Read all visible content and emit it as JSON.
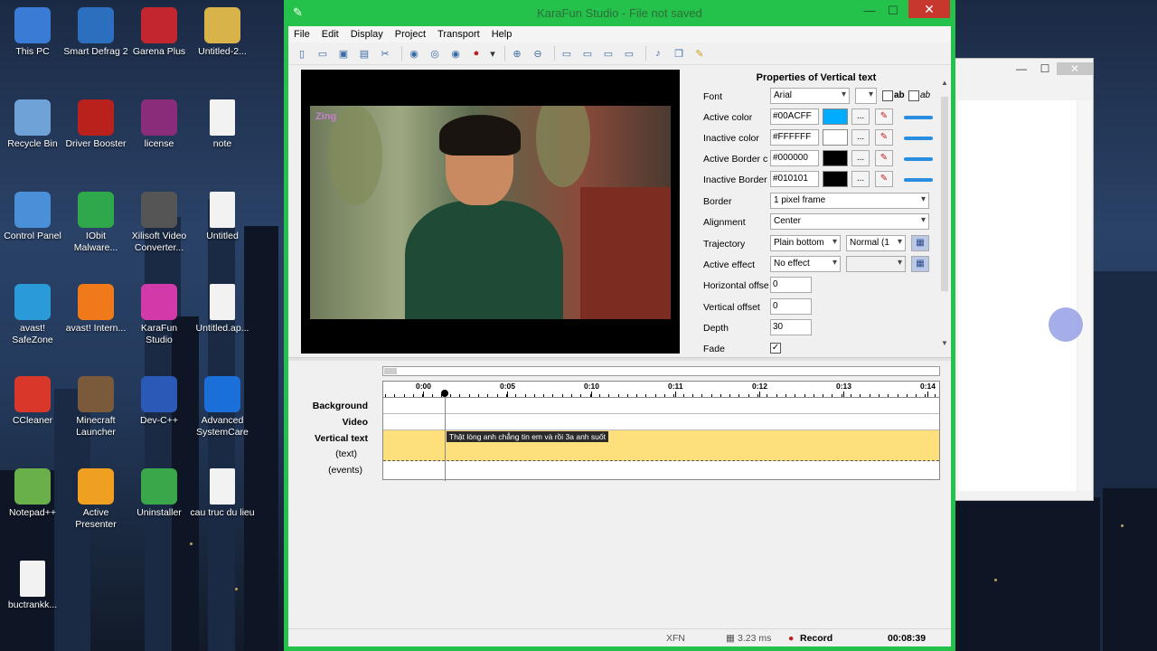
{
  "desktop": {
    "icons": [
      {
        "label": "This PC",
        "icon": "computer-icon",
        "color": "#3a7bd5"
      },
      {
        "label": "Smart Defrag 2",
        "icon": "defrag-icon",
        "color": "#2c6fbe"
      },
      {
        "label": "Garena Plus",
        "icon": "garena-icon",
        "color": "#c4262e"
      },
      {
        "label": "Untitled-2...",
        "icon": "folder-icon",
        "color": "#d8b34a"
      },
      {
        "label": "Recycle Bin",
        "icon": "recycle-bin-icon",
        "color": "#6fa3d8"
      },
      {
        "label": "Driver Booster",
        "icon": "driver-booster-icon",
        "color": "#b8211c"
      },
      {
        "label": "license",
        "icon": "winrar-icon",
        "color": "#8a2c7a"
      },
      {
        "label": "note",
        "icon": "document-icon",
        "color": "#f2f2f2"
      },
      {
        "label": "Control Panel",
        "icon": "control-panel-icon",
        "color": "#4a90d9"
      },
      {
        "label": "IObit Malware...",
        "icon": "iobit-icon",
        "color": "#2ea84a"
      },
      {
        "label": "Xilisoft Video Converter...",
        "icon": "film-reel-icon",
        "color": "#555555"
      },
      {
        "label": "Untitled",
        "icon": "vlc-document-icon",
        "color": "#f2f2f2"
      },
      {
        "label": "avast! SafeZone",
        "icon": "safezone-icon",
        "color": "#2a9ad8"
      },
      {
        "label": "avast! Intern...",
        "icon": "avast-icon",
        "color": "#f07a1a"
      },
      {
        "label": "KaraFun Studio",
        "icon": "karafun-icon",
        "color": "#d13aa8"
      },
      {
        "label": "Untitled.ap...",
        "icon": "document-icon",
        "color": "#f2f2f2"
      },
      {
        "label": "CCleaner",
        "icon": "ccleaner-icon",
        "color": "#d8372a"
      },
      {
        "label": "Minecraft Launcher",
        "icon": "minecraft-icon",
        "color": "#7a5a3a"
      },
      {
        "label": "Dev-C++",
        "icon": "devcpp-icon",
        "color": "#2a5ab8"
      },
      {
        "label": "Advanced SystemCare",
        "icon": "systemcare-icon",
        "color": "#1a6fd8"
      },
      {
        "label": "Notepad++",
        "icon": "notepadpp-icon",
        "color": "#6ab04a"
      },
      {
        "label": "Active Presenter",
        "icon": "active-presenter-icon",
        "color": "#f0a020"
      },
      {
        "label": "Uninstaller",
        "icon": "uninstaller-icon",
        "color": "#3aa84a"
      },
      {
        "label": "cau truc du lieu",
        "icon": "document-icon",
        "color": "#f2f2f2"
      },
      {
        "label": "buctrankk...",
        "icon": "document-icon",
        "color": "#f2f2f2"
      }
    ],
    "background_caret_text": "^^"
  },
  "window": {
    "title": "KaraFun Studio - File not saved",
    "minimize": "—",
    "maximize": "☐",
    "close": "✕",
    "accent": "#24c24a"
  },
  "menu": [
    "File",
    "Edit",
    "Display",
    "Project",
    "Transport",
    "Help"
  ],
  "video": {
    "logo": "Zing"
  },
  "properties": {
    "title": "Properties of Vertical text",
    "font_label": "Font",
    "font_value": "Arial",
    "font_size_value": "",
    "bold_label": "ab",
    "italic_label": "ab",
    "active_color_label": "Active color",
    "active_color_value": "#00ACFF",
    "inactive_color_label": "Inactive color",
    "inactive_color_value": "#FFFFFF",
    "active_border_label": "Active Border c",
    "active_border_value": "#000000",
    "inactive_border_label": "Inactive Border",
    "inactive_border_value": "#010101",
    "border_label": "Border",
    "border_value": "1 pixel frame",
    "alignment_label": "Alignment",
    "alignment_value": "Center",
    "trajectory_label": "Trajectory",
    "trajectory_value": "Plain bottom",
    "trajectory_mode_value": "Normal (1",
    "active_effect_label": "Active effect",
    "active_effect_value": "No effect",
    "h_offset_label": "Horizontal offse",
    "h_offset_value": "0",
    "v_offset_label": "Vertical offset",
    "v_offset_value": "0",
    "depth_label": "Depth",
    "depth_value": "30",
    "fade_label": "Fade",
    "fade_checked": true,
    "ellipsis": "...",
    "swatch_colors": [
      "#00ACFF",
      "#FFFFFF",
      "#000000",
      "#010101"
    ]
  },
  "timeline": {
    "ticks": [
      "0:00",
      "0:05",
      "0:10",
      "0:11",
      "0:12",
      "0:13",
      "0:14"
    ],
    "tracks": {
      "background": "Background",
      "video": "Video",
      "vertical_text": "Vertical text",
      "text": "(text)",
      "events": "(events)"
    },
    "lyric": "Thật lòng anh chẳng tin em và rồi 3a anh suốt"
  },
  "status": {
    "format": "XFN",
    "latency": "3.23 ms",
    "record": "Record",
    "time": "00:08:39"
  }
}
